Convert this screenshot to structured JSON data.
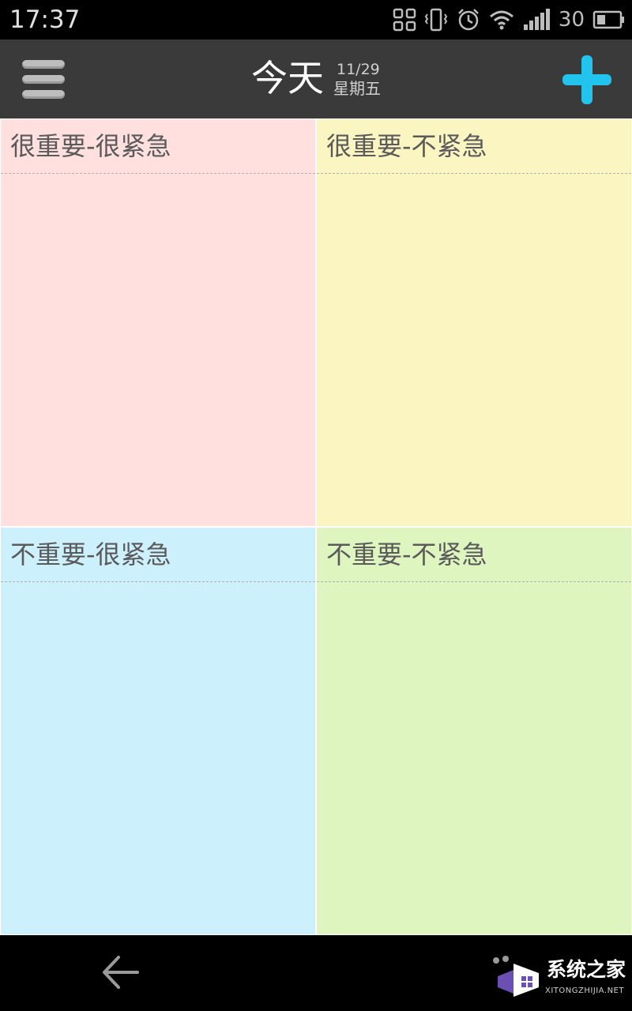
{
  "status_bar": {
    "time": "17:37",
    "battery_level": "30",
    "icons": [
      "nfc-icon",
      "vibrate-icon",
      "alarm-icon",
      "wifi-icon",
      "signal-icon",
      "battery-icon"
    ]
  },
  "header": {
    "title": "今天",
    "date": "11/29",
    "weekday": "星期五",
    "menu_icon": "hamburger-menu-icon",
    "add_icon": "plus-icon",
    "accent_color": "#22c4ee",
    "background_color": "#3a3a3a"
  },
  "quadrants": [
    {
      "label": "很重要-很紧急",
      "color": "#ffe0de"
    },
    {
      "label": "很重要-不紧急",
      "color": "#fbf5c2"
    },
    {
      "label": "不重要-很紧急",
      "color": "#cdf0fd"
    },
    {
      "label": "不重要-不紧急",
      "color": "#dff5c0"
    }
  ],
  "nav_bar": {
    "back_icon": "back-arrow-icon"
  },
  "watermark": {
    "text": "系统之家",
    "sub": "XITONGZHIJIA.NET"
  }
}
